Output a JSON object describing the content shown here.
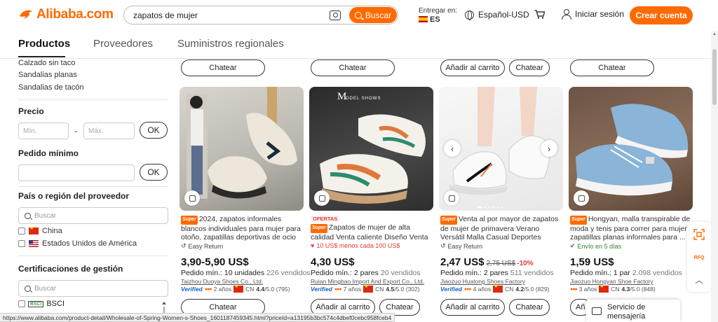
{
  "header": {
    "logo_text": "Alibaba.com",
    "search_query": "zapatos de mujer",
    "search_button": "Buscar",
    "deliver_label": "Entregar en:",
    "deliver_country": "ES",
    "language": "Español-USD",
    "signin": "Iniciar sesión",
    "create_account": "Crear cuenta"
  },
  "tabs": [
    "Productos",
    "Proveedores",
    "Suministros regionales"
  ],
  "sidebar": {
    "categories": [
      "Calzado sin taco",
      "Sandalias planas",
      "Sandalias de tacón"
    ],
    "price_heading": "Precio",
    "price_min_placeholder": "Mín.",
    "price_max_placeholder": "Máx.",
    "ok": "OK",
    "min_order_heading": "Pedido mínimo",
    "region_heading": "País o región del proveedor",
    "search_placeholder": "Buscar",
    "countries": [
      "China",
      "Estados Unidos de América"
    ],
    "cert_heading": "Certificaciones de gestión",
    "certs": [
      "BSCI"
    ],
    "bsci_logo": "BSCI"
  },
  "top_buttons": {
    "chat": "Chatear",
    "add_cart": "Añadir al carrito"
  },
  "products": [
    {
      "title": "2024, zapatos informales blancos individuales para mujer para otoño, zapatillas deportivas de ocio ...",
      "badge": "Super",
      "offer_tag": "",
      "extra": "Easy Return",
      "price": "3,90-5,90 US$",
      "old_price": "",
      "discount": "",
      "min_order": "Pedido mín.: 10 unidades",
      "sold": "226 vendidos",
      "supplier": "Taizhou Duoya Shoes Co., Ltd.",
      "years": "2 años",
      "country": "CN",
      "rating": "4.4",
      "rating_max": "/5.0 (795)",
      "buttons": [
        "Chatear"
      ]
    },
    {
      "title": "Zapatos de mujer de alta calidad Venta caliente Diseño Venta ...",
      "badge": "Super",
      "offer_tag": "OFERTAS",
      "extra": "10 US$ menos cada 100 US$",
      "price": "4,30 US$",
      "old_price": "",
      "discount": "",
      "min_order": "Pedido mín.: 2 pares",
      "sold": "20 vendidos",
      "supplier": "Ruian Mingbao Import And Export Co., Ltd.",
      "years": "7 años",
      "country": "CN",
      "rating": "4.5",
      "rating_max": "/5.0 (302)",
      "buttons": [
        "Añadir al carrito",
        "Chatear"
      ]
    },
    {
      "title": "Venta al por mayor de zapatos de mujer de primavera Verano Versátil Malla Casual Deportes Zapatos para ...",
      "badge": "Super",
      "offer_tag": "",
      "extra": "Easy Return",
      "price": "2,47 US$",
      "old_price": "2,75 US$",
      "discount": "-10%",
      "min_order": "Pedido mín.: 2 pares",
      "sold": "511 vendidos",
      "supplier": "Jiaozuo Huatong Shoes Factory",
      "years": "4 años",
      "country": "CN",
      "rating": "4.2",
      "rating_max": "/5.0 (829)",
      "buttons": [
        "Añadir al carrito",
        "Chatear"
      ]
    },
    {
      "title": "Hongyan, malla transpirable de moda y tenis para correr para mujer, zapatillas planas informales para ...",
      "badge": "Super",
      "offer_tag": "",
      "extra": "Envío en 5 días",
      "price": "1,59 US$",
      "old_price": "",
      "discount": "",
      "min_order": "Pedido mín.: 1 par",
      "sold": "2.098 vendidos",
      "supplier": "Jiaozuo Hongyan Shoe Factory",
      "years": "3 años",
      "country": "CN",
      "rating": "4.3",
      "rating_max": "/5.0 (848)",
      "buttons": [
        "Añ"
      ]
    }
  ],
  "image_overlay": {
    "line1": "M",
    "line2": "ODEL SHOWS"
  },
  "verified_label": "Verified",
  "float_label": "RFQ",
  "chat_popup": "Servicio de mensajería",
  "status_url": "https://www.alibaba.com/product-detail/Wholesale-of-Spring-Women-s-Shoes_1601187459345.html?priceId=a13195b3bc574c4dbef0cebc958fceb4",
  "colors": {
    "accent": "#ff6a00",
    "verified": "#1565c0",
    "discount": "#e53935",
    "shipping": "#2e7d32"
  }
}
